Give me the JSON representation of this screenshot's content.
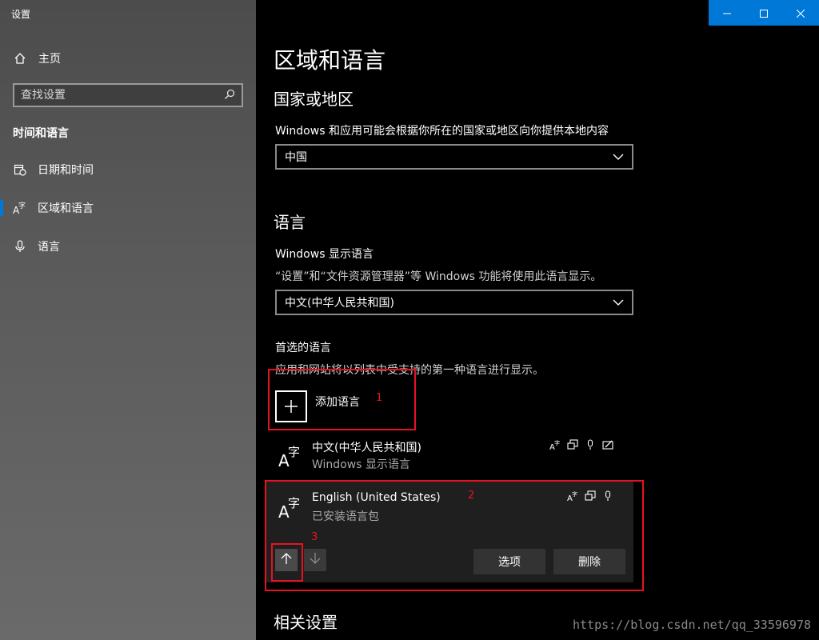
{
  "window": {
    "title": "设置"
  },
  "sidebar": {
    "home_label": "主页",
    "search_placeholder": "查找设置",
    "section_title": "时间和语言",
    "items": [
      {
        "label": "日期和时间",
        "icon": "clock-calendar-icon"
      },
      {
        "label": "区域和语言",
        "icon": "language-icon",
        "active": true
      },
      {
        "label": "语言",
        "icon": "microphone-icon"
      }
    ]
  },
  "main": {
    "page_title": "区域和语言",
    "region": {
      "heading": "国家或地区",
      "description": "Windows 和应用可能会根据你所在的国家或地区向你提供本地内容",
      "selected": "中国"
    },
    "language": {
      "heading": "语言",
      "display_label": "Windows 显示语言",
      "display_desc": "“设置”和“文件资源管理器”等 Windows 功能将使用此语言显示。",
      "display_selected": "中文(中华人民共和国)",
      "preferred_label": "首选的语言",
      "preferred_desc": "应用和网站将以列表中受支持的第一种语言进行显示。",
      "add_label": "添加语言",
      "languages": [
        {
          "name": "中文(中华人民共和国)",
          "status": "Windows 显示语言",
          "features": [
            "display-language-icon",
            "keyboard-icon",
            "speech-icon",
            "handwriting-icon"
          ]
        },
        {
          "name": "English (United States)",
          "status": "已安装语言包",
          "features": [
            "display-language-icon",
            "keyboard-icon",
            "speech-icon"
          ],
          "selected": true
        }
      ],
      "options_button": "选项",
      "remove_button": "删除"
    },
    "related": {
      "heading": "相关设置"
    }
  },
  "annotations": {
    "marker1": "1",
    "marker2": "2",
    "marker3": "3",
    "color": "#e81123"
  },
  "watermark": "https://blog.csdn.net/qq_33596978",
  "colors": {
    "accent": "#0078d7",
    "sidebar": "#555555",
    "background": "#000000"
  }
}
